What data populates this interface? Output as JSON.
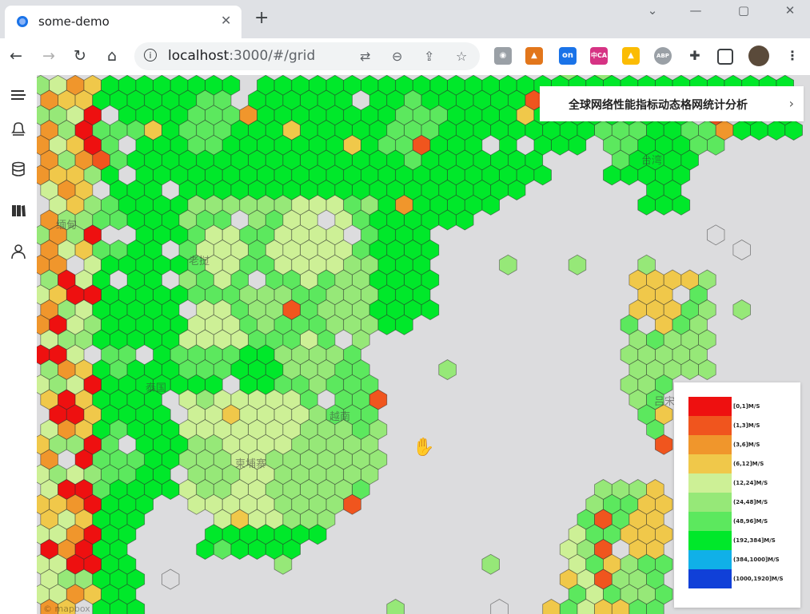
{
  "browser": {
    "tab_title": "some-demo",
    "tab_close": "✕",
    "new_tab": "+",
    "url_host": "localhost",
    "url_path": ":3000/#/grid",
    "window_controls": {
      "minimize": "—",
      "restore": "▢",
      "close": "✕",
      "dropdown": "⌄"
    },
    "extensions": [
      "translate-icon",
      "zoom-icon",
      "share-icon",
      "bookmark-star-icon",
      "ext-owl-icon",
      "metamask-icon",
      "ext-on-icon",
      "ext-cnca-icon",
      "google-drive-icon",
      "abp-icon",
      "puzzle-icon",
      "sidepanel-icon",
      "profile-avatar",
      "menu-icon"
    ],
    "ext_on_label": "on",
    "ext_cnca_label": "中CA",
    "ext_abp_label": "ABP"
  },
  "sidebar": {
    "items": [
      {
        "icon": "menu-collapse-icon"
      },
      {
        "icon": "bell-icon"
      },
      {
        "icon": "database-icon"
      },
      {
        "icon": "book-icon"
      },
      {
        "icon": "user-icon"
      }
    ]
  },
  "panel": {
    "title": "全球网络性能指标动态格网统计分析",
    "chevron": "›"
  },
  "map": {
    "places": [
      {
        "name": "缅甸"
      },
      {
        "name": "老挝"
      },
      {
        "name": "泰国"
      },
      {
        "name": "越南"
      },
      {
        "name": "柬埔寨"
      },
      {
        "name": "台湾"
      },
      {
        "name": "吕宋"
      }
    ],
    "attribution": "© mapbox"
  },
  "legend": {
    "items": [
      {
        "label": "[0,1]M/S",
        "color": "#ee1010"
      },
      {
        "label": "(1,3]M/S",
        "color": "#f0551e"
      },
      {
        "label": "(3,6]M/S",
        "color": "#f0962c"
      },
      {
        "label": "(6,12]M/S",
        "color": "#f0c84a"
      },
      {
        "label": "(12,24]M/S",
        "color": "#cdf096"
      },
      {
        "label": "(24,48]M/S",
        "color": "#96e878"
      },
      {
        "label": "(48,96]M/S",
        "color": "#5ce85e"
      },
      {
        "label": "(192,384]M/S",
        "color": "#00e82a"
      },
      {
        "label": "(384,1000]M/S",
        "color": "#10b0e8"
      },
      {
        "label": "(1000,1920]M/S",
        "color": "#1040d8"
      }
    ]
  }
}
